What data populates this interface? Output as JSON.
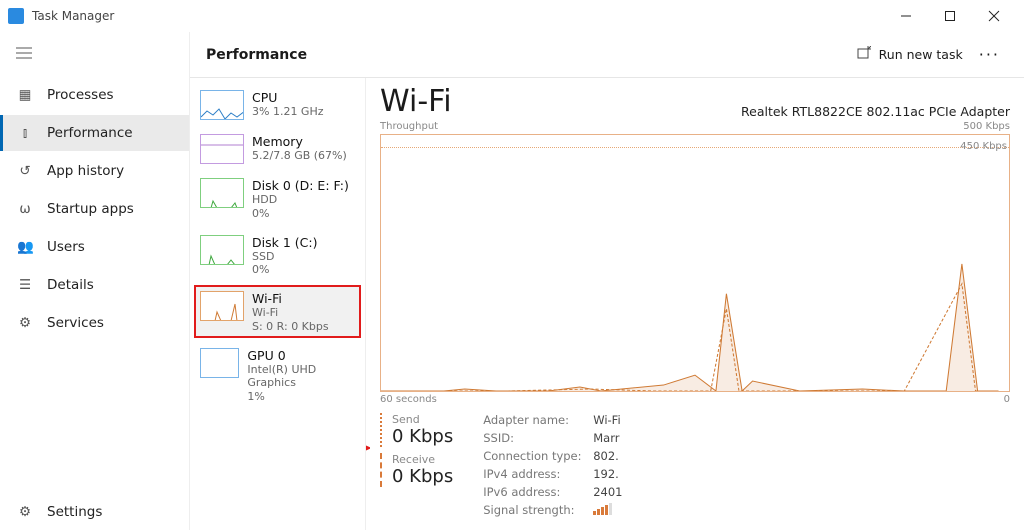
{
  "app_title": "Task Manager",
  "topbar": {
    "title": "Performance",
    "run_new_task": "Run new task"
  },
  "sidebar": {
    "items": [
      {
        "label": "Processes"
      },
      {
        "label": "Performance"
      },
      {
        "label": "App history"
      },
      {
        "label": "Startup apps"
      },
      {
        "label": "Users"
      },
      {
        "label": "Details"
      },
      {
        "label": "Services"
      }
    ],
    "settings": "Settings"
  },
  "perf_list": [
    {
      "title": "CPU",
      "sub": "3%  1.21 GHz"
    },
    {
      "title": "Memory",
      "sub": "5.2/7.8 GB (67%)"
    },
    {
      "title": "Disk 0 (D: E: F:)",
      "sub": "HDD",
      "sub2": "0%"
    },
    {
      "title": "Disk 1 (C:)",
      "sub": "SSD",
      "sub2": "0%"
    },
    {
      "title": "Wi-Fi",
      "sub": "Wi-Fi",
      "sub2": "S: 0 R: 0 Kbps"
    },
    {
      "title": "GPU 0",
      "sub": "Intel(R) UHD Graphics",
      "sub2": "1%"
    }
  ],
  "detail": {
    "heading": "Wi-Fi",
    "adapter": "Realtek RTL8822CE 802.11ac PCIe Adapter",
    "chart_label": "Throughput",
    "y_max": "500 Kbps",
    "y_line": "450 Kbps",
    "x_left": "60 seconds",
    "x_right": "0",
    "send_label": "Send",
    "send_value": "0 Kbps",
    "recv_label": "Receive",
    "recv_value": "0 Kbps",
    "info": {
      "adapter_name_k": "Adapter name:",
      "adapter_name_v": "Wi-Fi",
      "ssid_k": "SSID:",
      "ssid_v": "Marr",
      "conn_k": "Connection type:",
      "conn_v": "802.",
      "ipv4_k": "IPv4 address:",
      "ipv4_v": "192.",
      "ipv6_k": "IPv6 address:",
      "ipv6_v": "2401",
      "sig_k": "Signal strength:"
    }
  },
  "chart_data": {
    "type": "line",
    "title": "Throughput",
    "ylabel": "Kbps",
    "ylim": [
      0,
      500
    ],
    "x_seconds": [
      60,
      55,
      50,
      45,
      40,
      35,
      30,
      25,
      20,
      15,
      10,
      5,
      0
    ],
    "series": [
      {
        "name": "Send",
        "values": [
          0,
          0,
          5,
          0,
          10,
          0,
          0,
          20,
          30,
          180,
          20,
          0,
          240
        ]
      },
      {
        "name": "Receive",
        "values": [
          0,
          0,
          0,
          0,
          5,
          0,
          0,
          10,
          20,
          150,
          10,
          0,
          200
        ]
      }
    ],
    "annotations": [
      "450 Kbps"
    ]
  }
}
